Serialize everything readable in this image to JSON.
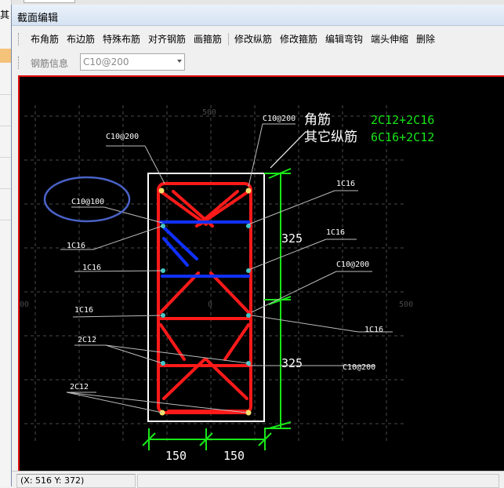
{
  "window": {
    "title": "截面编辑"
  },
  "background": {
    "clipped_text": "其"
  },
  "toolbar": {
    "items": [
      "布角筋",
      "布边筋",
      "特殊布筋",
      "对齐钢筋",
      "画箍筋",
      "修改纵筋",
      "修改箍筋",
      "编辑弯钩",
      "端头伸缩",
      "删除"
    ]
  },
  "rebar_info": {
    "label": "钢筋信息",
    "value": "C10@200"
  },
  "drawing": {
    "legend": {
      "corner_label": "角筋",
      "corner_value": "2C12+2C16",
      "other_label": "其它纵筋",
      "other_value": "6C16+2C12"
    },
    "dimensions": {
      "height_top": "325",
      "height_bottom": "325",
      "width_left": "150",
      "width_right": "150"
    },
    "axis_labels": {
      "top": "500",
      "left": "00",
      "center": "0",
      "right": "500"
    },
    "annotations": {
      "stirrup_top_left": "C10@200",
      "stirrup_top_right": "C10@200",
      "stirrup_circled": "C10@100",
      "side_right_1": "1C16",
      "side_right_2": "1C16",
      "stirrup_right_mid": "C10@200",
      "side_left_1": "1C16",
      "side_left_2": "1C16",
      "side_left_3": "1C16",
      "side_right_3": "1C16",
      "bottom_left_1": "2C12",
      "bottom_left_2": "2C12",
      "stirrup_bottom_right": "C10@200"
    },
    "colors": {
      "rebar": "#ff1a1a",
      "stirrup_blue": "#1030ff",
      "dim": "#19e619",
      "legend_value": "#19e619",
      "circle": "#4a62c8"
    }
  },
  "status": {
    "coords": "(X: 516 Y: 372)"
  }
}
